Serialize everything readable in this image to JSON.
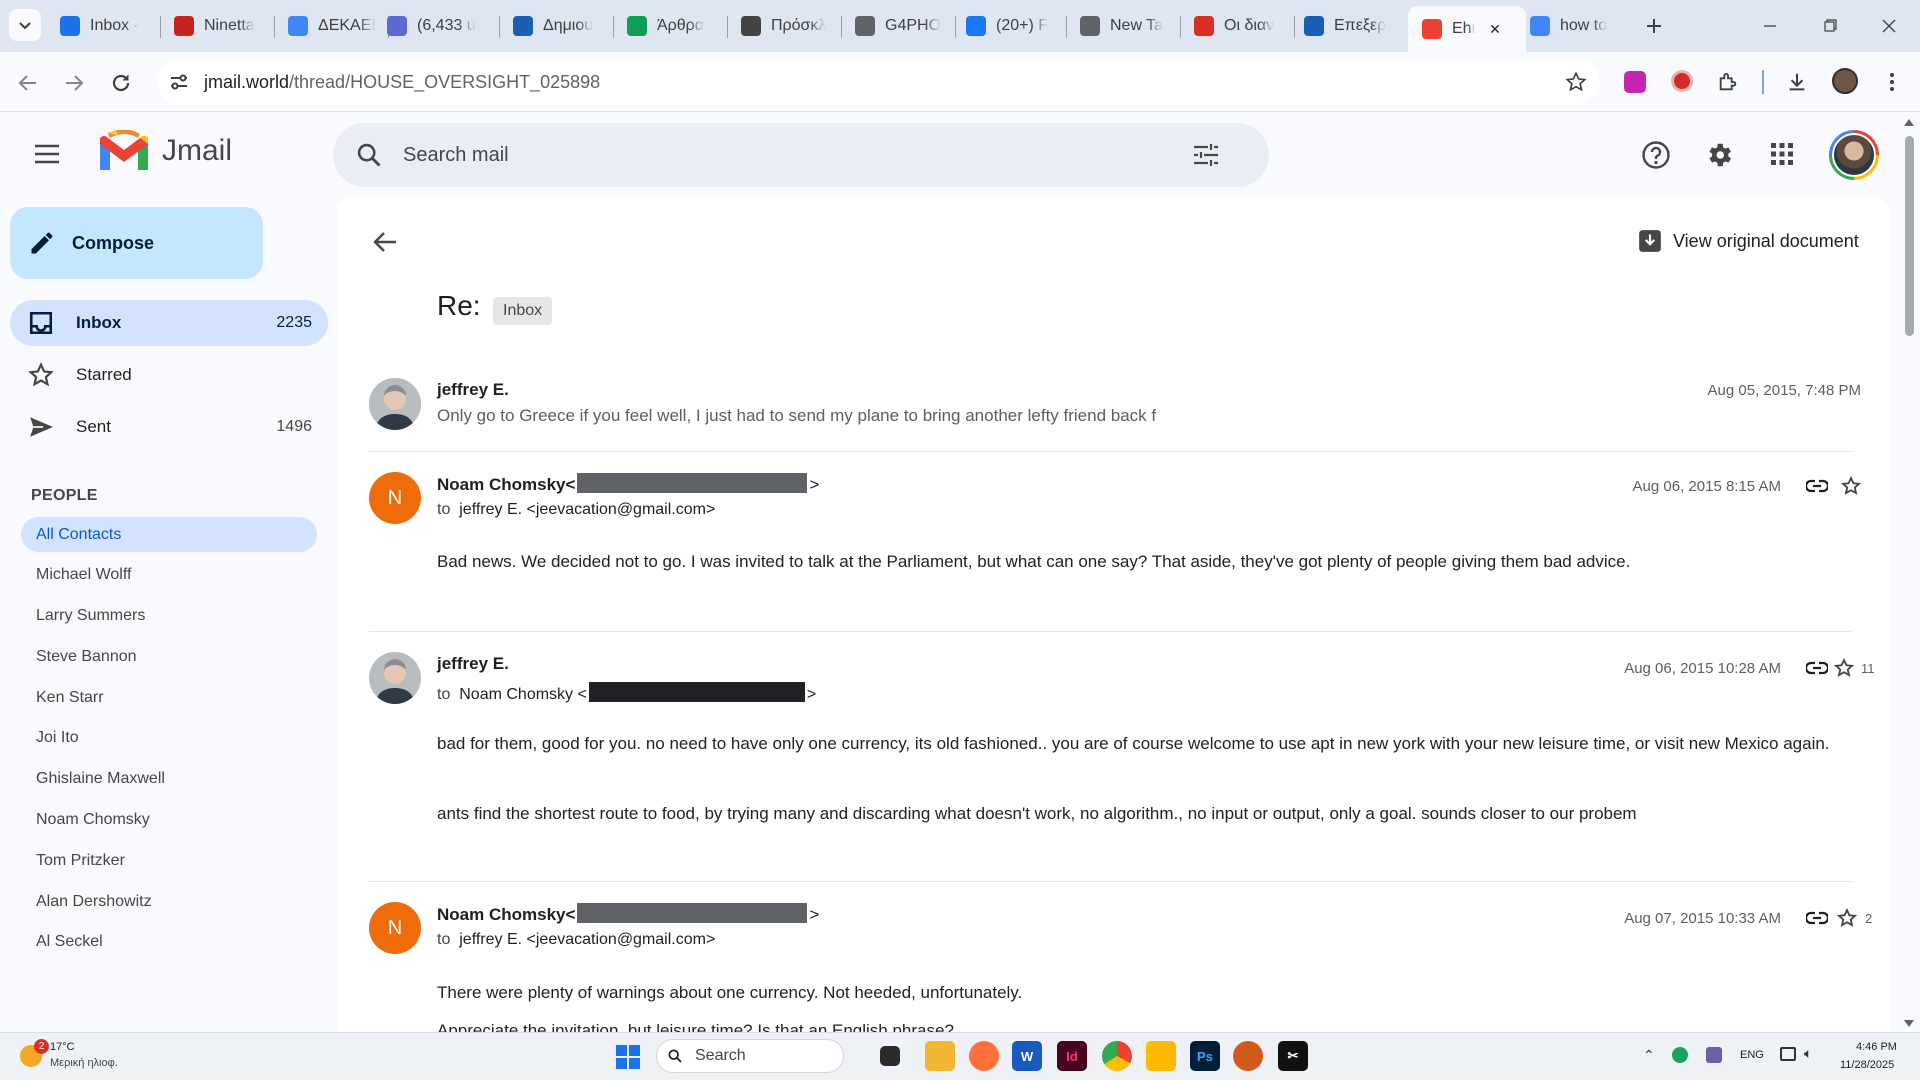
{
  "browser": {
    "tabs": [
      {
        "title": "Inbox -",
        "favicon": "onedrive-icon",
        "color": "#1a73e8"
      },
      {
        "title": "Ninetta",
        "favicon": "100plus-icon",
        "color": "#c5221f"
      },
      {
        "title": "ΔΕΚΑΕΙ",
        "favicon": "docs-icon",
        "color": "#4285f4"
      },
      {
        "title": "(6,433 u",
        "favicon": "mail-icon",
        "color": "#5b6ad0"
      },
      {
        "title": "Δημιου",
        "favicon": "onedrive-icon",
        "color": "#1a5fb4"
      },
      {
        "title": "Άρθρα",
        "favicon": "a-icon",
        "color": "#0f9d58"
      },
      {
        "title": "Πρόσκλ",
        "favicon": "ek-icon",
        "color": "#444444"
      },
      {
        "title": "G4PHO",
        "favicon": "globe-icon",
        "color": "#5f6368"
      },
      {
        "title": "(20+) F",
        "favicon": "facebook-icon",
        "color": "#1877f2"
      },
      {
        "title": "New Ta",
        "favicon": "chrome-icon",
        "color": "#5f6368"
      },
      {
        "title": "Οι διαν",
        "favicon": "lifo-icon",
        "color": "#d93025"
      },
      {
        "title": "Επεξερ",
        "favicon": "onedrive-icon",
        "color": "#1a5fb4"
      },
      {
        "title": "Εhι",
        "favicon": "gmail-icon",
        "color": "#ea4335",
        "active": true
      },
      {
        "title": "how to",
        "favicon": "google-icon",
        "color": "#4285f4"
      }
    ],
    "url_host": "jmail.world",
    "url_path": "/thread/HOUSE_OVERSIGHT_025898"
  },
  "app": {
    "logo_text": "Jmail",
    "search_placeholder": "Search mail",
    "compose_label": "Compose",
    "nav": [
      {
        "label": "Inbox",
        "count": "2235",
        "active": true,
        "icon": "inbox-icon"
      },
      {
        "label": "Starred",
        "count": "",
        "icon": "star-icon"
      },
      {
        "label": "Sent",
        "count": "1496",
        "icon": "send-icon"
      }
    ],
    "people_heading": "PEOPLE",
    "contacts": [
      "All Contacts",
      "Michael Wolff",
      "Larry Summers",
      "Steve Bannon",
      "Ken Starr",
      "Joi Ito",
      "Ghislaine Maxwell",
      "Noam Chomsky",
      "Tom Pritzker",
      "Alan Dershowitz",
      "Al Seckel"
    ]
  },
  "thread": {
    "view_original_label": "View original document",
    "subject": "Re:",
    "label_chip": "Inbox",
    "messages": [
      {
        "sender": "jeffrey E.",
        "snippet": "Only go to Greece if you feel well, I just had to send my plane to bring another lefty friend back f",
        "date": "Aug 05, 2015, 7:48 PM"
      },
      {
        "sender": "Noam Chomsky<",
        "sender_close": ">",
        "avatar_letter": "N",
        "to_label": "to",
        "to": "jeffrey E. <jeevacation@gmail.com>",
        "date": "Aug 06, 2015 8:15 AM",
        "body": [
          "Bad news. We decided not to go. I was invited to talk at the Parliament, but what can one say? That aside, they've got plenty of people giving them bad advice."
        ]
      },
      {
        "sender": "jeffrey E.",
        "to_label": "to",
        "to_open": "Noam Chomsky <",
        "to_close": ">",
        "date": "Aug 06, 2015 10:28 AM",
        "star_count": "11",
        "body": [
          "bad for them, good for you. no need to have only one currency, its old fashioned.. you are of course welcome to use apt in new york with your new leisure time, or visit new Mexico again.",
          "ants find the shortest route to food, by trying many and discarding what doesn't work, no algorithm., no input or output, only a goal. sounds closer to our probem"
        ]
      },
      {
        "sender": "Noam Chomsky<",
        "sender_close": ">",
        "avatar_letter": "N",
        "to_label": "to",
        "to": "jeffrey E. <jeevacation@gmail.com>",
        "date": "Aug 07, 2015 10:33 AM",
        "star_count": "2",
        "body": [
          "There were plenty of warnings about one currency. Not heeded, unfortunately.",
          "Appreciate the invitation, but leisure time? Is that an English phrase?"
        ]
      }
    ]
  },
  "taskbar": {
    "weather_temp": "17°C",
    "weather_desc": "Μερική ηλιοφ.",
    "weather_badge": "2",
    "search_label": "Search",
    "lang": "ENG",
    "time": "4:46 PM",
    "date": "11/28/2025"
  },
  "colors": {
    "accent": "#c2e7ff",
    "active_nav": "#d3e3fd",
    "avatar_orange": "#ee6c0a"
  }
}
